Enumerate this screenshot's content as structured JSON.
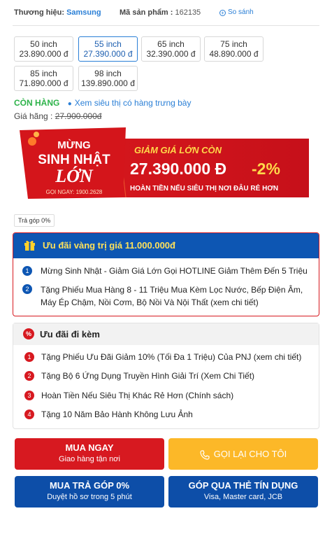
{
  "meta": {
    "brand_label": "Thương hiệu:",
    "brand_value": "Samsung",
    "sku_label": "Mã sản phẩm :",
    "sku_value": "162135",
    "compare_label": "So sánh"
  },
  "sizes": [
    {
      "label": "50 inch",
      "price": "23.890.000 đ",
      "active": false
    },
    {
      "label": "55 inch",
      "price": "27.390.000 đ",
      "active": true
    },
    {
      "label": "65 inch",
      "price": "32.390.000 đ",
      "active": false
    },
    {
      "label": "75 inch",
      "price": "48.890.000 đ",
      "active": false
    },
    {
      "label": "85 inch",
      "price": "71.890.000 đ",
      "active": false
    },
    {
      "label": "98 inch",
      "price": "139.890.000 đ",
      "active": false
    }
  ],
  "stock": {
    "status": "CÒN HÀNG",
    "store_link": "Xem siêu thị có hàng trưng bày"
  },
  "list_price": {
    "label": "Giá hãng :",
    "value": "27.900.000đ"
  },
  "banner": {
    "line1": "MỪNG",
    "line2": "SINH NHẬT",
    "line3": "LỚN",
    "hotline": "GỌI NGAY: 1900.2628",
    "headline": "GIẢM GIÁ LỚN CÒN",
    "price": "27.390.000 Đ",
    "discount": "-2%",
    "refund": "HOÀN TIỀN NẾU SIÊU THỊ NƠI ĐÂU RẺ HƠN"
  },
  "installment_tag": "Trả góp 0%",
  "gold_offer": {
    "title": "Ưu đãi vàng trị giá 11.000.000đ",
    "items": [
      "Mừng Sinh Nhật - Giảm Giá Lớn Gọi HOTLINE Giảm Thêm Đến 5 Triệu",
      "Tặng Phiếu Mua Hàng 8 - 11 Triệu Mua Kèm Lọc Nước, Bếp Điện Âm, Máy Ép Chậm, Nồi Cơm, Bộ Nồi Và Nội Thất (xem chi tiết)"
    ]
  },
  "extra_offer": {
    "title": "Ưu đãi đi kèm",
    "items": [
      "Tặng Phiếu Ưu Đãi Giảm 10% (Tối Đa 1 Triệu) Của PNJ (xem chi tiết)",
      "Tặng Bộ 6 Ứng Dụng Truyền Hình Giải Trí (Xem Chi Tiết)",
      "Hoàn Tiền Nếu Siêu Thị Khác Rẻ Hơn (Chính sách)",
      "Tặng 10 Năm Bảo Hành Không Lưu Ảnh"
    ]
  },
  "buttons": {
    "buy_title": "MUA NGAY",
    "buy_sub": "Giao hàng tận nơi",
    "call_title": "GỌI LẠI CHO TÔI",
    "installment_title": "MUA TRẢ GÓP 0%",
    "installment_sub": "Duyệt hồ sơ trong 5 phút",
    "card_title": "GÓP QUA THẺ TÍN DỤNG",
    "card_sub": "Visa, Master card, JCB"
  },
  "colors": {
    "primary_blue": "#0d56b3",
    "accent_red": "#d71920",
    "call_yellow": "#fcb828",
    "stock_green": "#2db34a"
  }
}
